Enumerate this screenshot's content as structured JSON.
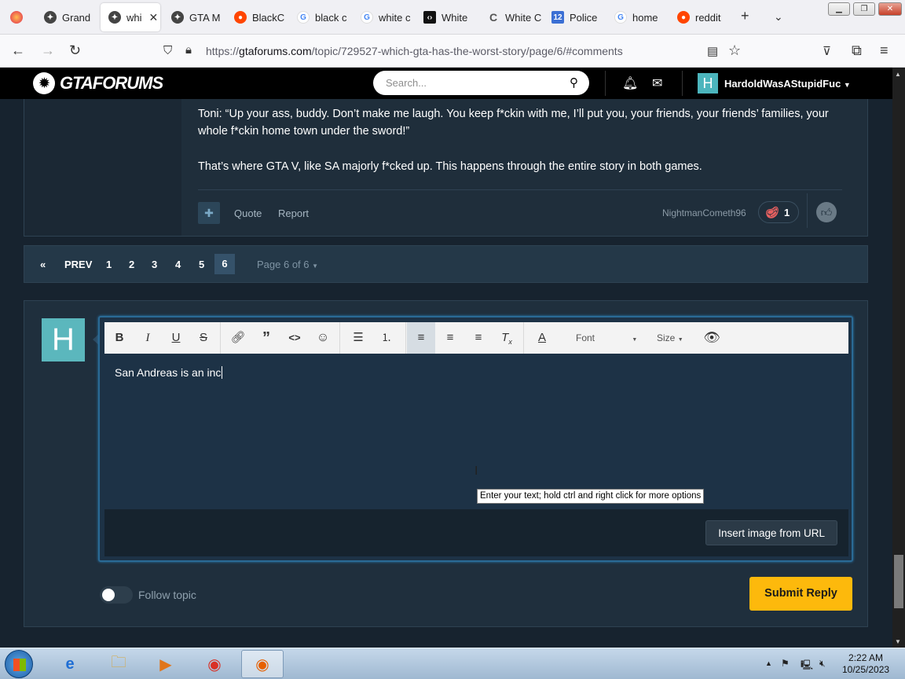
{
  "browser": {
    "tabs": [
      {
        "title": "Grand",
        "favicon": "gta-icon",
        "color": "#444444"
      },
      {
        "title": "whi",
        "favicon": "gta-icon",
        "color": "#444444",
        "active": true
      },
      {
        "title": "GTA M",
        "favicon": "gta-icon",
        "color": "#444444"
      },
      {
        "title": "BlackC",
        "favicon": "reddit-icon",
        "color": "#ff4500"
      },
      {
        "title": "black c",
        "favicon": "google-icon",
        "color": "#4285f4"
      },
      {
        "title": "white c",
        "favicon": "google-icon",
        "color": "#4285f4"
      },
      {
        "title": "White",
        "favicon": "dark-site-icon",
        "color": "#111111"
      },
      {
        "title": "White C",
        "favicon": "c-icon",
        "color": "#666666"
      },
      {
        "title": "Police",
        "favicon": "calendar-icon",
        "color": "#3b6fd4"
      },
      {
        "title": "home",
        "favicon": "google-icon",
        "color": "#4285f4"
      },
      {
        "title": "reddit",
        "favicon": "reddit-icon",
        "color": "#ff4500"
      }
    ],
    "url_prefix": "https://",
    "url_host": "gtaforums.com",
    "url_path": "/topic/729527-which-gta-has-the-worst-story/page/6/#comments"
  },
  "site": {
    "logo_text": "GTAFORUMS",
    "search_placeholder": "Search...",
    "user_initial": "H",
    "user_name": "HardoldWasAStupidFuc"
  },
  "post": {
    "paragraphs": [
      "Toni: “Up your ass, buddy. Don’t make me laugh. You keep f*ckin with me, I’ll put you, your friends, your friends’ families, your whole f*ckin home town under the sword!”",
      "That’s where GTA V, like SA majorly f*cked up. This happens through the entire story in both games."
    ],
    "quote_label": "Quote",
    "report_label": "Report",
    "reacted_by": "NightmanCometh96",
    "reaction_count": "1"
  },
  "pagination": {
    "prev_label": "PREV",
    "pages": [
      "1",
      "2",
      "3",
      "4",
      "5"
    ],
    "current": "6",
    "info": "Page 6 of 6"
  },
  "reply": {
    "avatar_initial": "H",
    "font_label": "Font",
    "size_label": "Size",
    "text": "San Andreas is an inc",
    "tooltip": "Enter your text; hold ctrl and right click for more options",
    "insert_image_label": "Insert image from URL",
    "follow_label": "Follow topic",
    "submit_label": "Submit Reply"
  },
  "taskbar": {
    "time": "2:22 AM",
    "date": "10/25/2023"
  },
  "colors": {
    "accent": "#fdb90c",
    "avatar": "#5bb7bd",
    "panel": "#1f2f3d"
  }
}
